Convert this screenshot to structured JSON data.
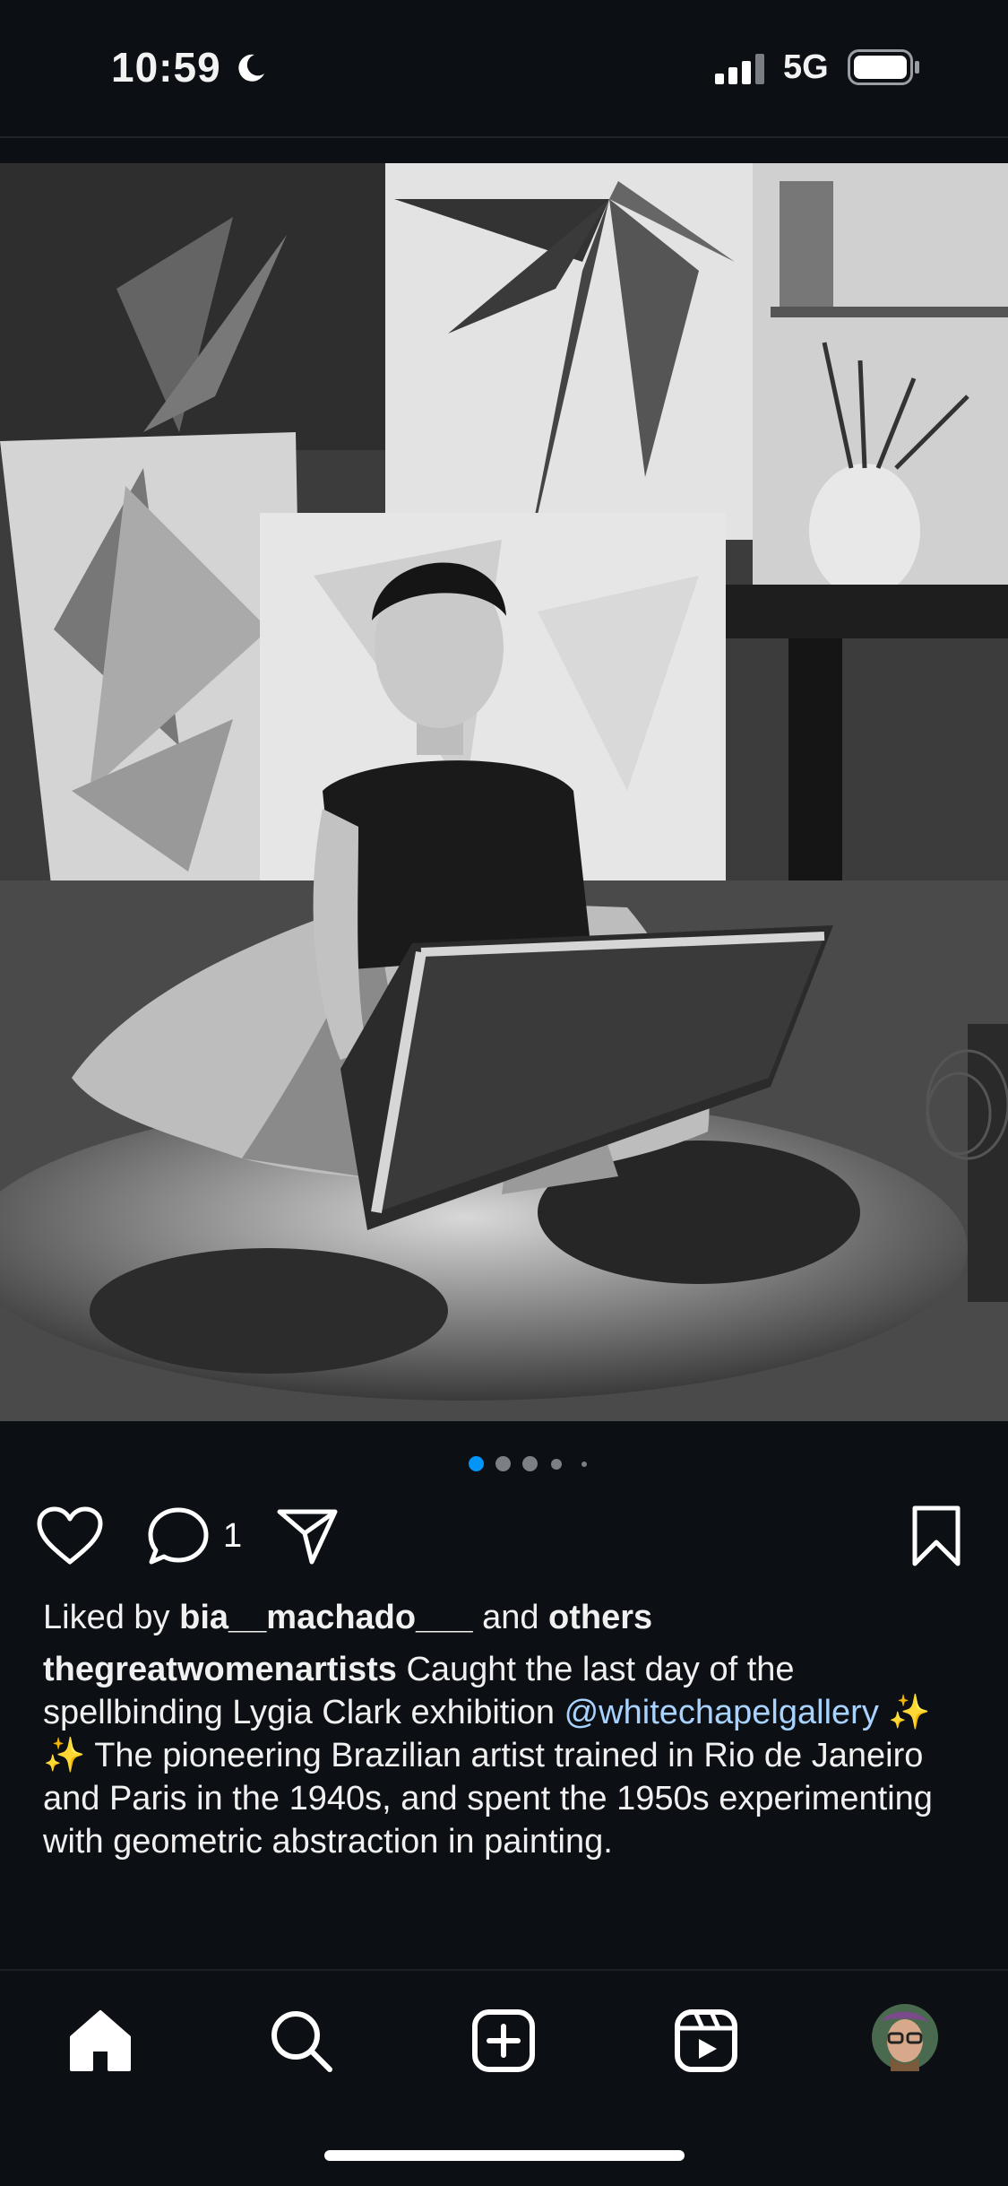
{
  "status_bar": {
    "time": "10:59",
    "network": "5G",
    "icons": [
      "moon-icon",
      "signal-icon",
      "battery-icon"
    ]
  },
  "post": {
    "carousel": {
      "total": 5,
      "active_index": 0
    },
    "actions": {
      "icons": [
        "heart-icon",
        "comment-icon",
        "share-icon",
        "bookmark-icon"
      ],
      "comment_count": "1"
    },
    "likes": {
      "prefix": "Liked by",
      "user": "bia__machado___",
      "connector": "and",
      "others": "others"
    },
    "caption": {
      "username": "thegreatwomenartists",
      "text_1": " Caught the last day of the spellbinding Lygia Clark exhibition ",
      "mention": "@whitechapelgallery",
      "emojis": " ✨ ✨",
      "text_2": " The pioneering Brazilian artist trained in Rio de Janeiro and Paris in the 1940s, and spent the 1950s experimenting with geometric abstraction in painting."
    }
  },
  "bottom_nav": {
    "items": [
      "home-icon",
      "search-icon",
      "create-icon",
      "reels-icon",
      "profile-avatar"
    ]
  },
  "colors": {
    "background": "#0c0f14",
    "accent_blue": "#0095f6",
    "mention": "#a9d3ff"
  }
}
